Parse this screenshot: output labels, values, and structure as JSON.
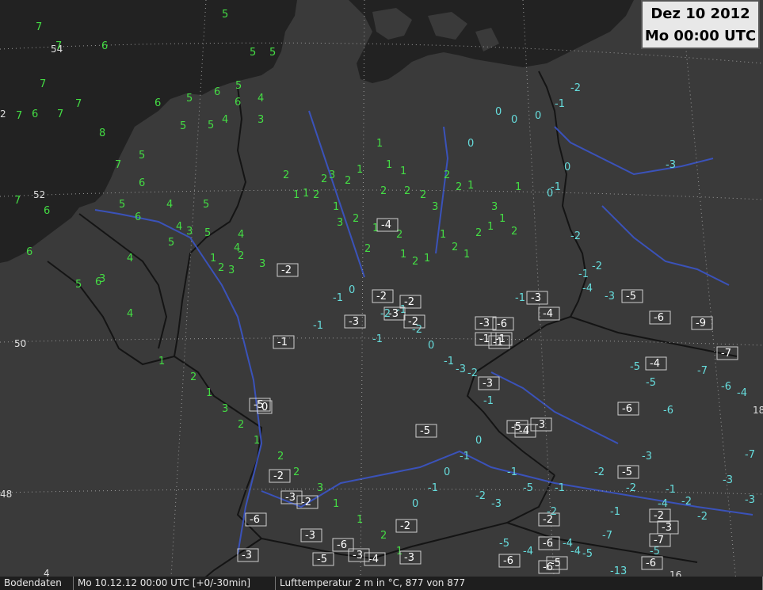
{
  "header": {
    "date": "Dez 10 2012",
    "time": "Mo 00:00 UTC"
  },
  "statusbar": {
    "source": "Bodendaten",
    "valid": "Mo 10.12.12 00:00 UTC [+0/-30min]",
    "parameter": "Lufttemperatur 2 m in °C, 877 von 877"
  },
  "colors": {
    "sea": "#222222",
    "land": "#3a3a3a",
    "border": "#141414",
    "river": "#3b55c8",
    "positive": "#44dd44",
    "zero_neg": "#66dddd",
    "boxed": "#ffffff"
  },
  "grid_labels": {
    "lat": [
      "54",
      "52",
      "50",
      "48"
    ],
    "lon": [
      "4",
      "16",
      "18",
      "2"
    ]
  },
  "stations": [
    {
      "t": "5",
      "c": "p"
    },
    {
      "t": "7",
      "c": "p"
    },
    {
      "t": "6",
      "c": "p"
    },
    {
      "t": "7",
      "c": "p"
    },
    {
      "t": "5",
      "c": "p"
    },
    {
      "t": "5",
      "c": "p"
    },
    {
      "t": "7",
      "c": "p"
    },
    {
      "t": "7",
      "c": "p"
    },
    {
      "t": "6",
      "c": "p"
    },
    {
      "t": "5",
      "c": "p"
    },
    {
      "t": "6",
      "c": "p"
    },
    {
      "t": "7",
      "c": "p"
    },
    {
      "t": "6",
      "c": "p"
    },
    {
      "t": "7",
      "c": "p"
    },
    {
      "t": "5",
      "c": "p"
    },
    {
      "t": "4",
      "c": "p"
    },
    {
      "t": "5",
      "c": "p"
    },
    {
      "t": "6",
      "c": "p"
    },
    {
      "t": "8",
      "c": "p"
    },
    {
      "t": "7",
      "c": "p"
    },
    {
      "t": "5",
      "c": "p"
    },
    {
      "t": "4",
      "c": "p"
    },
    {
      "t": "3",
      "c": "p"
    },
    {
      "t": "5",
      "c": "p"
    },
    {
      "t": "6",
      "c": "p"
    },
    {
      "t": "7",
      "c": "p"
    },
    {
      "t": "5",
      "c": "p"
    },
    {
      "t": "6",
      "c": "p"
    },
    {
      "t": "4",
      "c": "p"
    },
    {
      "t": "5",
      "c": "p"
    },
    {
      "t": "6",
      "c": "p"
    },
    {
      "t": "4",
      "c": "p"
    },
    {
      "t": "3",
      "c": "p"
    },
    {
      "t": "6",
      "c": "p"
    },
    {
      "t": "5",
      "c": "p"
    },
    {
      "t": "4",
      "c": "p"
    },
    {
      "t": "5",
      "c": "p"
    },
    {
      "t": "4",
      "c": "p"
    },
    {
      "t": "3",
      "c": "p"
    },
    {
      "t": "4",
      "c": "p"
    },
    {
      "t": "6",
      "c": "p"
    },
    {
      "t": "5",
      "c": "p"
    },
    {
      "t": "2",
      "c": "p"
    },
    {
      "t": "3",
      "c": "p"
    },
    {
      "t": "4",
      "c": "p"
    },
    {
      "t": "1",
      "c": "p"
    },
    {
      "t": "2",
      "c": "p"
    },
    {
      "t": "3",
      "c": "p"
    },
    {
      "t": "2",
      "c": "p"
    },
    {
      "t": "1",
      "c": "p"
    },
    {
      "t": "1",
      "c": "p"
    },
    {
      "t": "2",
      "c": "p"
    },
    {
      "t": "2",
      "c": "p"
    },
    {
      "t": "3",
      "c": "p"
    },
    {
      "t": "2",
      "c": "p"
    },
    {
      "t": "1",
      "c": "p"
    },
    {
      "t": "1",
      "c": "p"
    },
    {
      "t": "2",
      "c": "p"
    },
    {
      "t": "1",
      "c": "p"
    },
    {
      "t": "1",
      "c": "p"
    },
    {
      "t": "2",
      "c": "p"
    },
    {
      "t": "2",
      "c": "p"
    },
    {
      "t": "3",
      "c": "p"
    },
    {
      "t": "2",
      "c": "p"
    },
    {
      "t": "2",
      "c": "p"
    },
    {
      "t": "1",
      "c": "p"
    },
    {
      "t": "1",
      "c": "p"
    },
    {
      "t": "3",
      "c": "p"
    },
    {
      "t": "2",
      "c": "p"
    },
    {
      "t": "2",
      "c": "p"
    },
    {
      "t": "1",
      "c": "p"
    },
    {
      "t": "2",
      "c": "p"
    },
    {
      "t": "1",
      "c": "p"
    },
    {
      "t": "2",
      "c": "p"
    },
    {
      "t": "1",
      "c": "p"
    },
    {
      "t": "1",
      "c": "p"
    },
    {
      "t": "2",
      "c": "p"
    },
    {
      "t": "1",
      "c": "p"
    },
    {
      "t": "2",
      "c": "p"
    },
    {
      "t": "1",
      "c": "p"
    },
    {
      "t": "1",
      "c": "p"
    },
    {
      "t": "2",
      "c": "p"
    },
    {
      "t": "3",
      "c": "p"
    },
    {
      "t": "1",
      "c": "p"
    },
    {
      "t": "0",
      "c": "n"
    },
    {
      "t": "0",
      "c": "n"
    },
    {
      "t": "0",
      "c": "n"
    },
    {
      "t": "0",
      "c": "n"
    },
    {
      "t": "0",
      "c": "n"
    },
    {
      "t": "0",
      "c": "n"
    },
    {
      "t": "-1",
      "c": "n"
    },
    {
      "t": "-1",
      "c": "n"
    },
    {
      "t": "-2",
      "c": "n"
    },
    {
      "t": "-1",
      "c": "n"
    },
    {
      "t": "-2",
      "c": "n"
    },
    {
      "t": "-3",
      "c": "n"
    },
    {
      "t": "-1",
      "c": "n"
    },
    {
      "t": "-2",
      "c": "n"
    },
    {
      "t": "-3",
      "c": "n"
    },
    {
      "t": "-4",
      "c": "n"
    },
    {
      "t": "-5",
      "c": "n"
    },
    {
      "t": "-5",
      "c": "n"
    },
    {
      "t": "-6",
      "c": "n"
    },
    {
      "t": "-7",
      "c": "n"
    },
    {
      "t": "-7",
      "c": "n"
    },
    {
      "t": "-6",
      "c": "n"
    },
    {
      "t": "-4",
      "c": "n"
    },
    {
      "t": "-3",
      "c": "n"
    },
    {
      "t": "-2",
      "c": "n"
    },
    {
      "t": "-1",
      "c": "n"
    },
    {
      "t": "-2",
      "c": "n"
    },
    {
      "t": "-3",
      "c": "n"
    },
    {
      "t": "-4",
      "c": "n"
    },
    {
      "t": "-5",
      "c": "n"
    },
    {
      "t": "-2",
      "c": "n"
    },
    {
      "t": "-1",
      "c": "n"
    },
    {
      "t": "-3",
      "c": "n"
    },
    {
      "t": "-2",
      "c": "n"
    },
    {
      "t": "-1",
      "c": "n"
    },
    {
      "t": "-2",
      "c": "n"
    },
    {
      "t": "-5",
      "c": "n"
    },
    {
      "t": "-4",
      "c": "n"
    },
    {
      "t": "-3",
      "c": "n"
    },
    {
      "t": "-2",
      "c": "n"
    },
    {
      "t": "-1",
      "c": "n"
    },
    {
      "t": "-5",
      "c": "n"
    },
    {
      "t": "-7",
      "c": "n"
    },
    {
      "t": "-4",
      "c": "n"
    },
    {
      "t": "-13",
      "c": "n"
    },
    {
      "t": "-5",
      "c": "n"
    },
    {
      "t": "-4",
      "c": "n"
    },
    {
      "t": "-9",
      "c": "n"
    },
    {
      "t": "-1",
      "c": "n"
    },
    {
      "t": "0",
      "c": "n"
    },
    {
      "t": "-1",
      "c": "n"
    },
    {
      "t": "-2",
      "c": "n"
    },
    {
      "t": "-1",
      "c": "n"
    },
    {
      "t": "-2",
      "c": "n"
    },
    {
      "t": "-1",
      "c": "n"
    },
    {
      "t": "0",
      "c": "n"
    },
    {
      "t": "-1",
      "c": "n"
    },
    {
      "t": "-3",
      "c": "n"
    },
    {
      "t": "-2",
      "c": "n"
    },
    {
      "t": "-1",
      "c": "n"
    },
    {
      "t": "1",
      "c": "p"
    },
    {
      "t": "2",
      "c": "p"
    },
    {
      "t": "1",
      "c": "p"
    },
    {
      "t": "3",
      "c": "p"
    },
    {
      "t": "2",
      "c": "p"
    },
    {
      "t": "1",
      "c": "p"
    },
    {
      "t": "2",
      "c": "p"
    },
    {
      "t": "2",
      "c": "p"
    },
    {
      "t": "3",
      "c": "p"
    },
    {
      "t": "1",
      "c": "p"
    },
    {
      "t": "1",
      "c": "p"
    },
    {
      "t": "2",
      "c": "p"
    },
    {
      "t": "1",
      "c": "p"
    },
    {
      "t": "0",
      "c": "n"
    },
    {
      "t": "-1",
      "c": "n"
    },
    {
      "t": "0",
      "c": "n"
    },
    {
      "t": "-1",
      "c": "n"
    },
    {
      "t": "0",
      "c": "n"
    }
  ],
  "boxed_stations": [
    "-4",
    "-2",
    "-2",
    "-2",
    "-3",
    "-3",
    "-2",
    "-1",
    "-3",
    "-6",
    "-1",
    "-3",
    "-4",
    "-5",
    "-6",
    "-9",
    "-7",
    "-4",
    "-3",
    "-5",
    "-3",
    "-6",
    "-5",
    "0",
    "-2",
    "-3",
    "-2",
    "-6",
    "-2",
    "-3",
    "-2",
    "-6",
    "-6",
    "-5",
    "-4",
    "-3",
    "-1",
    "-4",
    "-5",
    "-2",
    "-3",
    "-7",
    "-6",
    "-3",
    "-6",
    "-5",
    "-3",
    "-1",
    "-6",
    "-5"
  ]
}
